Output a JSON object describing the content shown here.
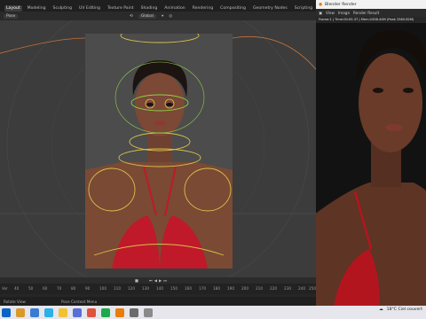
{
  "blender": {
    "workspace_tabs": [
      "Layout",
      "Modeling",
      "Sculpting",
      "UV Editing",
      "Texture Paint",
      "Shading",
      "Animation",
      "Rendering",
      "Compositing",
      "Geometry Nodes",
      "Scripting",
      "+"
    ],
    "active_tab_index": 0,
    "header": {
      "mode_label": "Pose",
      "orientation_label": "Global"
    },
    "timeline": {
      "left_label": "Ver",
      "ticks": [
        "40",
        "50",
        "60",
        "70",
        "80",
        "90",
        "100",
        "110",
        "120",
        "130",
        "140",
        "150",
        "160",
        "170",
        "180",
        "190",
        "200",
        "210",
        "220",
        "230",
        "240",
        "250"
      ]
    },
    "statusbar": {
      "left": "Rotate View",
      "middle": "Pose Context Menu"
    }
  },
  "render_window": {
    "title": "Blender Render",
    "toolbar": {
      "view_label": "View",
      "image_label": "Image",
      "result_label": "Render Result"
    },
    "info": "Frame:1 | Time:00:05.37 | Mem:2458.44M (Peak 2560.82M)"
  },
  "taskbar": {
    "weather": "18°C  Ciel couvert",
    "colors": {
      "bg": "#e6e6ec"
    }
  }
}
